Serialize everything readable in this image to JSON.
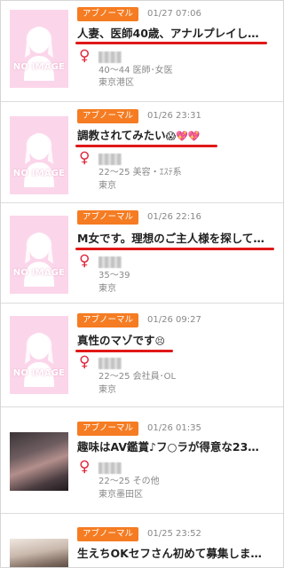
{
  "posts": [
    {
      "category": "アブノーマル",
      "date": "01/27 07:06",
      "title": "人妻、医師40歳、アナルプレイし…",
      "emoji": "",
      "age_job": "40～44 医師･女医",
      "location": "東京港区",
      "thumbnail": "NO IMAGE",
      "underlined": true
    },
    {
      "category": "アブノーマル",
      "date": "01/26 23:31",
      "title": "調教されてみたい",
      "emoji": "😱💖💖",
      "age_job": "22～25 美容・ｴｽﾃ系",
      "location": "東京",
      "thumbnail": "NO IMAGE",
      "underlined": true
    },
    {
      "category": "アブノーマル",
      "date": "01/26 22:16",
      "title": "M女です。理想のご主人様を探して…",
      "emoji": "",
      "age_job": "35～39",
      "location": "東京",
      "thumbnail": "NO IMAGE",
      "underlined": true
    },
    {
      "category": "アブノーマル",
      "date": "01/26 09:27",
      "title": "真性のマゾです",
      "emoji": "😣",
      "age_job": "22～25 会社員･OL",
      "location": "東京",
      "thumbnail": "NO IMAGE",
      "underlined": true
    },
    {
      "category": "アブノーマル",
      "date": "01/26 01:35",
      "title": "趣味はAV鑑賞♪フ○ラが得意な23…",
      "emoji": "",
      "age_job": "22～25 その他",
      "location": "東京墨田区",
      "thumbnail": "",
      "underlined": false
    },
    {
      "category": "アブノーマル",
      "date": "01/25 23:52",
      "title": "生えちOKセフさん初めて募集しま…",
      "emoji": "",
      "age_job": "",
      "location": "",
      "thumbnail": "",
      "underlined": false
    }
  ],
  "gender_symbol": "♀",
  "colors": {
    "badge": "#f57c22",
    "underline": "#e01818",
    "venus": "#e0283c",
    "noimage_bg": "#fbd6ea"
  }
}
